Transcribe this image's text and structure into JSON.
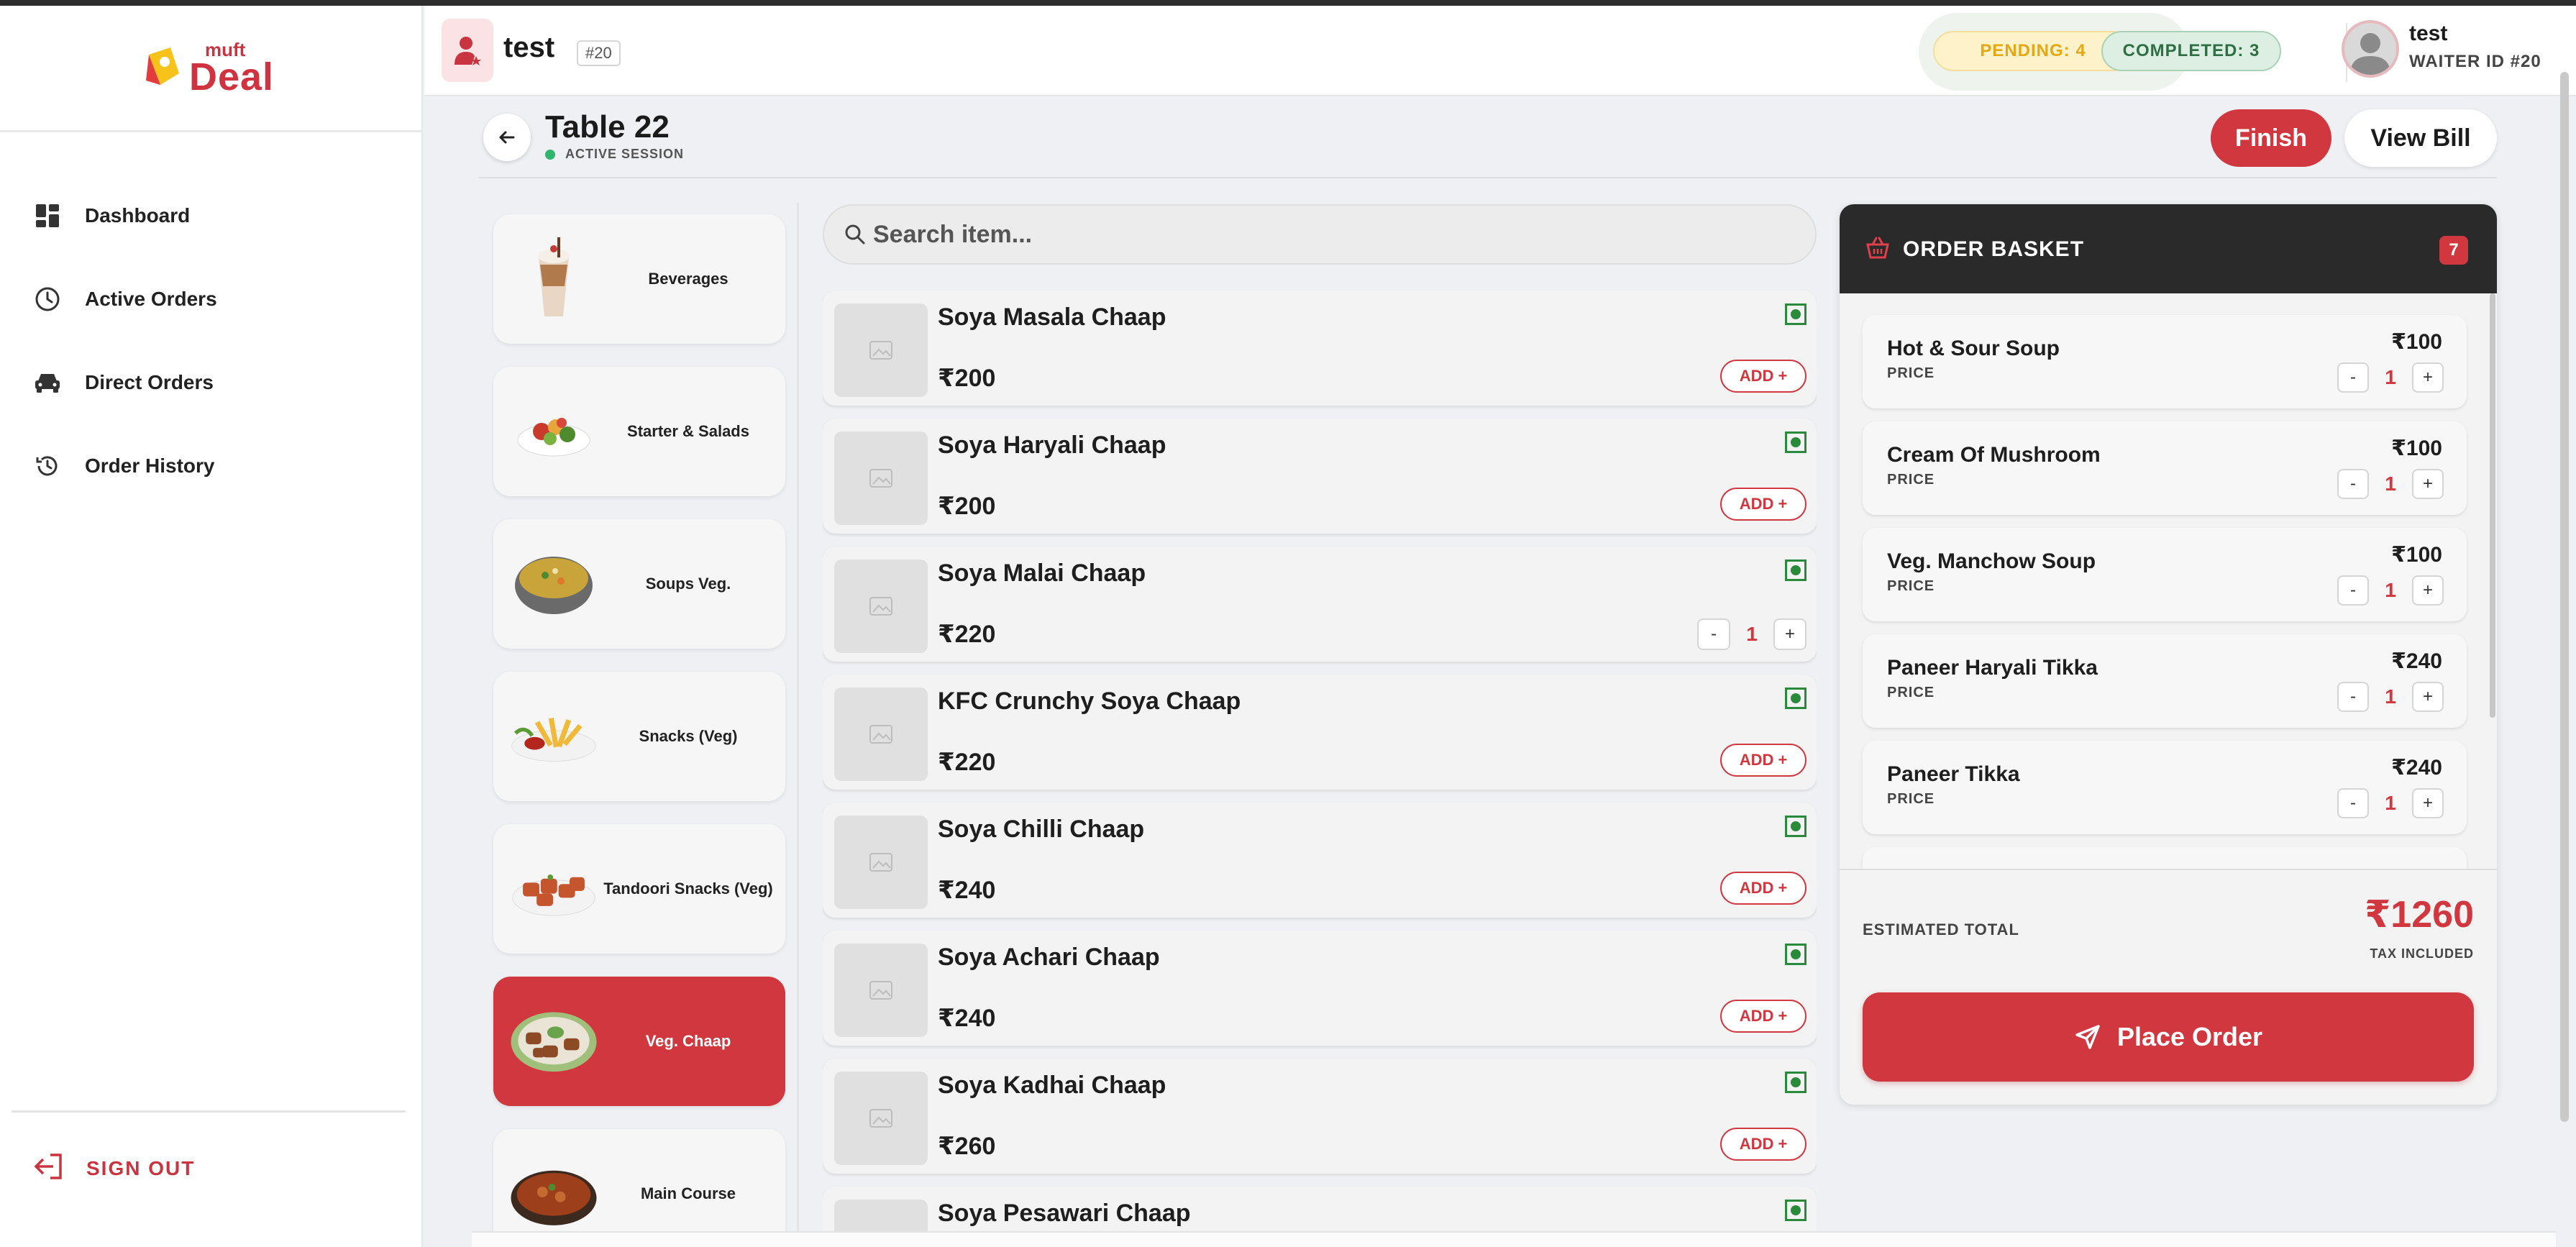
{
  "brand": {
    "small": "muft",
    "big": "Deal"
  },
  "sidebar": {
    "items": [
      {
        "label": "Dashboard"
      },
      {
        "label": "Active Orders"
      },
      {
        "label": "Direct Orders"
      },
      {
        "label": "Order History"
      }
    ],
    "signout": "SIGN OUT"
  },
  "header": {
    "restaurant_name": "test",
    "restaurant_id": "#20",
    "pending": "PENDING: 4",
    "completed": "COMPLETED: 3",
    "user_name": "test",
    "user_role": "WAITER ID #20"
  },
  "table": {
    "title": "Table 22",
    "session": "ACTIVE SESSION",
    "finish": "Finish",
    "view_bill": "View Bill"
  },
  "categories": [
    {
      "label": "Beverages",
      "active": false
    },
    {
      "label": "Starter & Salads",
      "active": false
    },
    {
      "label": "Soups Veg.",
      "active": false
    },
    {
      "label": "Snacks (Veg)",
      "active": false
    },
    {
      "label": "Tandoori Snacks (Veg)",
      "active": false
    },
    {
      "label": "Veg. Chaap",
      "active": true
    },
    {
      "label": "Main Course",
      "active": false
    }
  ],
  "search": {
    "placeholder": "Search item..."
  },
  "items": [
    {
      "name": "Soya Masala Chaap",
      "price": "₹200",
      "add": "ADD +"
    },
    {
      "name": "Soya Haryali Chaap",
      "price": "₹200",
      "add": "ADD +"
    },
    {
      "name": "Soya Malai Chaap",
      "price": "₹220",
      "qty": "1"
    },
    {
      "name": "KFC Crunchy Soya Chaap",
      "price": "₹220",
      "add": "ADD +"
    },
    {
      "name": "Soya Chilli Chaap",
      "price": "₹240",
      "add": "ADD +"
    },
    {
      "name": "Soya Achari Chaap",
      "price": "₹240",
      "add": "ADD +"
    },
    {
      "name": "Soya Kadhai Chaap",
      "price": "₹260",
      "add": "ADD +"
    },
    {
      "name": "Soya Pesawari Chaap",
      "price": ""
    }
  ],
  "stepper": {
    "minus": "-",
    "plus": "+"
  },
  "basket": {
    "title": "ORDER BASKET",
    "count": "7",
    "price_label": "PRICE",
    "rows": [
      {
        "name": "Hot & Sour Soup",
        "price": "₹100",
        "qty": "1"
      },
      {
        "name": "Cream Of Mushroom",
        "price": "₹100",
        "qty": "1"
      },
      {
        "name": "Veg. Manchow Soup",
        "price": "₹100",
        "qty": "1"
      },
      {
        "name": "Paneer Haryali Tikka",
        "price": "₹240",
        "qty": "1"
      },
      {
        "name": "Paneer Tikka",
        "price": "₹240",
        "qty": "1"
      }
    ],
    "estimated_label": "ESTIMATED TOTAL",
    "estimated_total": "₹1260",
    "tax_label": "TAX INCLUDED",
    "place_order": "Place Order"
  },
  "colors": {
    "accent": "#d0373f",
    "dark": "#2a2a2a",
    "veg": "#2a8a3c"
  }
}
